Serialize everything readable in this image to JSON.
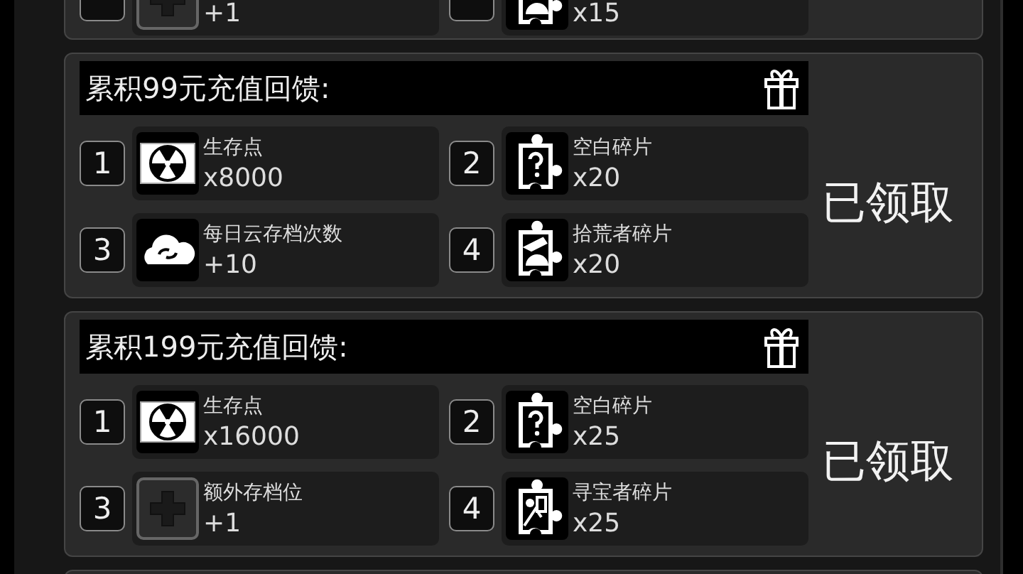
{
  "partial_card": {
    "items": [
      {
        "kind": "slot",
        "amount": "+1"
      },
      {
        "kind": "puzzle-scavenger",
        "amount": "x15"
      }
    ]
  },
  "cards": [
    {
      "title": "累积99元充值回馈:",
      "status": "已领取",
      "claimed": true,
      "items": [
        {
          "number": "1",
          "kind": "radiation",
          "name": "生存点",
          "amount": "x8000"
        },
        {
          "number": "2",
          "kind": "puzzle-question",
          "name": "空白碎片",
          "amount": "x20"
        },
        {
          "number": "3",
          "kind": "cloud",
          "name": "每日云存档次数",
          "amount": "+10"
        },
        {
          "number": "4",
          "kind": "puzzle-scavenger",
          "name": "拾荒者碎片",
          "amount": "x20"
        }
      ]
    },
    {
      "title": "累积199元充值回馈:",
      "status": "已领取",
      "claimed": true,
      "items": [
        {
          "number": "1",
          "kind": "radiation",
          "name": "生存点",
          "amount": "x16000"
        },
        {
          "number": "2",
          "kind": "puzzle-question",
          "name": "空白碎片",
          "amount": "x25"
        },
        {
          "number": "3",
          "kind": "slot",
          "name": "额外存档位",
          "amount": "+1"
        },
        {
          "number": "4",
          "kind": "puzzle-treasure",
          "name": "寻宝者碎片",
          "amount": "x25"
        }
      ]
    }
  ]
}
